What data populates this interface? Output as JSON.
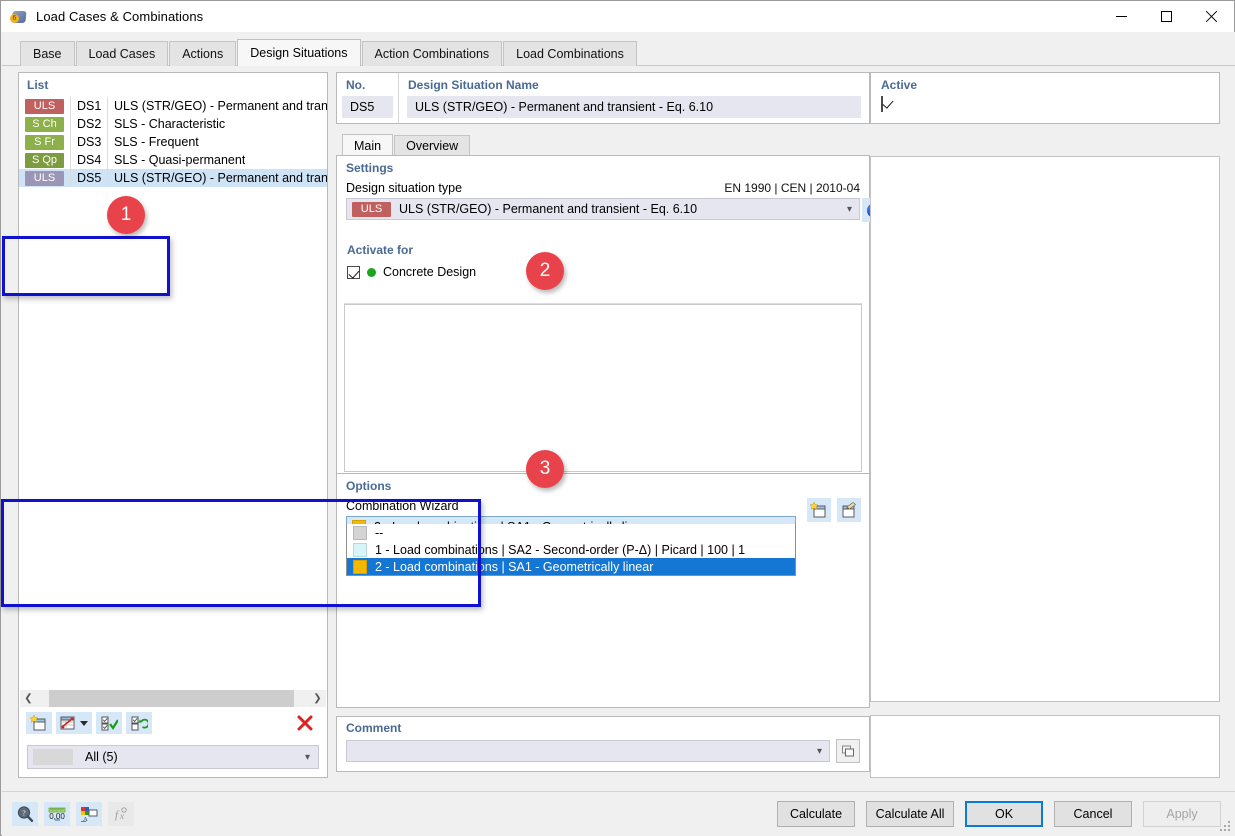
{
  "window": {
    "title": "Load Cases & Combinations",
    "icon": "load-cases-icon",
    "minimize": "minimize-icon",
    "maximize": "maximize-icon",
    "close": "close-icon"
  },
  "tabs": [
    {
      "label": "Base",
      "active": false
    },
    {
      "label": "Load Cases",
      "active": false
    },
    {
      "label": "Actions",
      "active": false
    },
    {
      "label": "Design Situations",
      "active": true
    },
    {
      "label": "Action Combinations",
      "active": false
    },
    {
      "label": "Load Combinations",
      "active": false
    }
  ],
  "list": {
    "label": "List",
    "rows": [
      {
        "badge": "ULS",
        "badge_color": "#c0605f",
        "no": "DS1",
        "desc": "ULS (STR/GEO) - Permanent and transient - E",
        "selected": false
      },
      {
        "badge": "S Ch",
        "badge_color": "#8db04a",
        "no": "DS2",
        "desc": "SLS - Characteristic",
        "selected": false
      },
      {
        "badge": "S Fr",
        "badge_color": "#8db04a",
        "no": "DS3",
        "desc": "SLS - Frequent",
        "selected": false
      },
      {
        "badge": "S Qp",
        "badge_color": "#7d9c3f",
        "no": "DS4",
        "desc": "SLS - Quasi-permanent",
        "selected": false
      },
      {
        "badge": "ULS",
        "badge_color": "#9b96b5",
        "no": "DS5",
        "desc": "ULS (STR/GEO) - Permanent and transient - E",
        "selected": true
      }
    ],
    "toolbar": [
      {
        "name": "new-design-situation-button",
        "icon": "new-page-star-icon"
      },
      {
        "name": "import-design-situations-button",
        "icon": "table-import-icon"
      },
      {
        "name": "select-all-button",
        "icon": "check-all-icon"
      },
      {
        "name": "invert-selection-button",
        "icon": "invert-selection-icon"
      },
      {
        "name": "delete-button",
        "icon": "red-x-icon"
      }
    ],
    "filter": {
      "value": "All (5)",
      "caret": "chevron-down-icon"
    },
    "scrollbar": {
      "left_arrow": "chevron-left-icon",
      "right_arrow": "chevron-right-icon"
    }
  },
  "detail": {
    "no": {
      "label": "No.",
      "value": "DS5"
    },
    "name": {
      "label": "Design Situation Name",
      "value": "ULS (STR/GEO) - Permanent and transient - Eq. 6.10"
    },
    "edit_button_icon": "pencil-edit-icon",
    "inner_tabs": [
      {
        "label": "Main",
        "active": true
      },
      {
        "label": "Overview",
        "active": false
      }
    ],
    "settings": {
      "label": "Settings",
      "type_label": "Design situation type",
      "standard": "EN 1990 | CEN | 2010-04",
      "type_badge": "ULS",
      "type_badge_color": "#c0605f",
      "type_value": "ULS (STR/GEO) - Permanent and transient - Eq. 6.10",
      "caret": "chevron-down-icon",
      "info_icon": "info-icon"
    },
    "activate_for": {
      "label": "Activate for",
      "item": "Concrete Design",
      "checked": true,
      "status_color": "#1aa51a"
    },
    "options": {
      "label": "Options",
      "wizard_label": "Combination Wizard",
      "selected": {
        "swatch": "#f5b800",
        "text": "2 - Load combinations | SA1 - Geometrically linear"
      },
      "caret": "chevron-down-icon",
      "items": [
        {
          "swatch": "#d4d4d4",
          "text": "--",
          "selected": false
        },
        {
          "swatch": "#d5f5fa",
          "text": "1 - Load combinations | SA2 - Second-order (P-Δ) | Picard | 100 | 1",
          "selected": false
        },
        {
          "swatch": "#f5b800",
          "text": "2 - Load combinations | SA1 - Geometrically linear",
          "selected": true
        }
      ],
      "buttons": [
        {
          "name": "new-combination-wizard-button",
          "icon": "new-page-star-icon"
        },
        {
          "name": "edit-combination-wizard-button",
          "icon": "edit-page-icon"
        }
      ]
    },
    "comment": {
      "label": "Comment",
      "value": "",
      "caret": "chevron-down-icon",
      "button_icon": "copy-windows-icon"
    }
  },
  "active_panel": {
    "label": "Active",
    "checked": true
  },
  "annotations": [
    {
      "number": "1"
    },
    {
      "number": "2"
    },
    {
      "number": "3"
    }
  ],
  "footer": {
    "tools": [
      {
        "name": "help-button",
        "icon": "help-magnifier-icon",
        "disabled": false
      },
      {
        "name": "units-button",
        "icon": "units-000-icon",
        "disabled": false
      },
      {
        "name": "display-properties-button",
        "icon": "display-properties-icon",
        "disabled": false
      },
      {
        "name": "formula-button",
        "icon": "fx-formula-icon",
        "disabled": true
      }
    ],
    "buttons": [
      {
        "label": "Calculate",
        "style": "normal"
      },
      {
        "label": "Calculate All",
        "style": "wide"
      },
      {
        "label": "OK",
        "style": "primary"
      },
      {
        "label": "Cancel",
        "style": "normal"
      },
      {
        "label": "Apply",
        "style": "disabled"
      }
    ]
  },
  "colors": {
    "accent_blue": "#1477d4",
    "annotation_red": "#e8434a",
    "highlight_border": "#1010cf"
  }
}
